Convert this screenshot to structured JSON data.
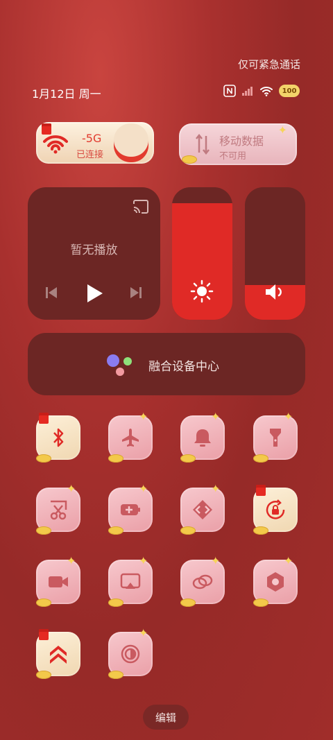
{
  "status": {
    "emergency_text": "仅可紧急通话",
    "date": "1月12日 周一",
    "battery": "100"
  },
  "wifi_tile": {
    "name": "-5G",
    "status": "已连接"
  },
  "data_tile": {
    "name": "移动数据",
    "status": "不可用"
  },
  "media": {
    "status": "暂无播放"
  },
  "brightness": {
    "level": 0.88
  },
  "volume": {
    "level": 0.26
  },
  "device_center": {
    "label": "融合设备中心"
  },
  "footer": {
    "edit_label": "编辑"
  },
  "tiles": [
    {
      "icon": "bluetooth-icon"
    },
    {
      "icon": "airplane-icon"
    },
    {
      "icon": "bell-icon"
    },
    {
      "icon": "flashlight-icon"
    },
    {
      "icon": "screenshot-icon"
    },
    {
      "icon": "battery-saver-icon"
    },
    {
      "icon": "hotspot-icon"
    },
    {
      "icon": "rotation-lock-icon"
    },
    {
      "icon": "screen-record-icon"
    },
    {
      "icon": "cast-icon"
    },
    {
      "icon": "link-icon"
    },
    {
      "icon": "nfc-settings-icon"
    },
    {
      "icon": "performance-icon"
    },
    {
      "icon": "dark-mode-icon"
    }
  ],
  "colors": {
    "accent": "#e02a26",
    "panel": "#6c2624"
  }
}
